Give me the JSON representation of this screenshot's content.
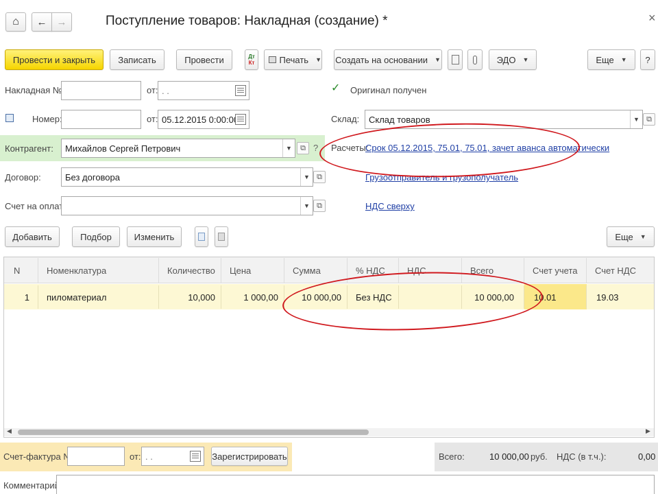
{
  "window": {
    "title": "Поступление товаров: Накладная (создание) *",
    "close_glyph": "×",
    "home_glyph": "⌂",
    "back_glyph": "←",
    "forward_glyph": "→"
  },
  "toolbar": {
    "post_close": "Провести и закрыть",
    "save": "Записать",
    "post": "Провести",
    "dtkt_top": "Дт",
    "dtkt_bottom": "Кт",
    "print": "Печать",
    "create_based": "Создать на основании",
    "edo": "ЭДО",
    "more": "Еще",
    "help": "?"
  },
  "form": {
    "invoice_no_label": "Накладная №:",
    "invoice_no_value": "",
    "from_label": "от:",
    "invoice_date_value": ". .",
    "number_label": "Номер:",
    "number_value": "",
    "date_value": "05.12.2015  0:00:00",
    "original_label": "Оригинал получен",
    "original_checked": true,
    "warehouse_label": "Склад:",
    "warehouse_value": "Склад товаров",
    "counterparty_label": "Контрагент:",
    "counterparty_value": "Михайлов Сергей Петрович",
    "contract_label": "Договор:",
    "contract_value": "Без договора",
    "payment_invoice_label": "Счет на оплату:",
    "payment_invoice_value": "",
    "settlements_label": "Расчеты:",
    "settlements_link": "Срок 05.12.2015, 75.01, 75.01, зачет аванса автоматически",
    "consignor_link": "Грузоотправитель и грузополучатель",
    "vat_link": "НДС сверху",
    "question": "?"
  },
  "table_toolbar": {
    "add": "Добавить",
    "pick": "Подбор",
    "edit": "Изменить",
    "more": "Еще"
  },
  "table": {
    "columns": [
      "N",
      "Номенклатура",
      "Количество",
      "Цена",
      "Сумма",
      "% НДС",
      "НДС",
      "Всего",
      "Счет учета",
      "Счет НДС"
    ],
    "rows": [
      {
        "n": "1",
        "item": "пиломатериал",
        "qty": "10,000",
        "price": "1 000,00",
        "sum": "10 000,00",
        "vat_rate": "Без НДС",
        "vat": "",
        "total": "10 000,00",
        "account": "10.01",
        "vat_account": "19.03"
      }
    ]
  },
  "footer": {
    "invoice_label": "Счет-фактура №:",
    "invoice_value": "",
    "from_label": "от:",
    "invoice_date": ". .",
    "register": "Зарегистрировать",
    "total_label": "Всего:",
    "total_value": "10 000,00",
    "currency": "руб.",
    "vat_label": "НДС (в т.ч.):",
    "vat_value": "0,00",
    "comment_label": "Комментарий:",
    "comment_value": ""
  },
  "colors": {
    "primary_button": "#f6d500",
    "highlight_row": "#fdf8d4",
    "counterparty_bg": "#d8f0cf",
    "annotation": "#d0191e",
    "link": "#1f3fa5"
  }
}
